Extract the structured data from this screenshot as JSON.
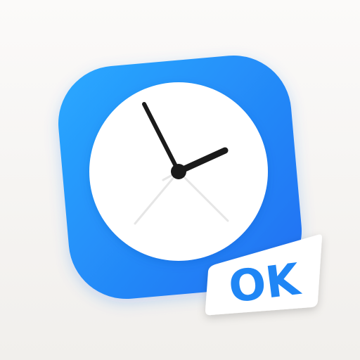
{
  "app_icon": {
    "name": "clock-app-icon",
    "badge_text": "OK",
    "colors": {
      "tile_light": "#2aa9ff",
      "tile_dark": "#1f6ff2",
      "clock_face": "#ffffff",
      "hands": "#1a1a1a",
      "badge_text": "#1f86f5",
      "badge_background": "#ffffff"
    }
  }
}
